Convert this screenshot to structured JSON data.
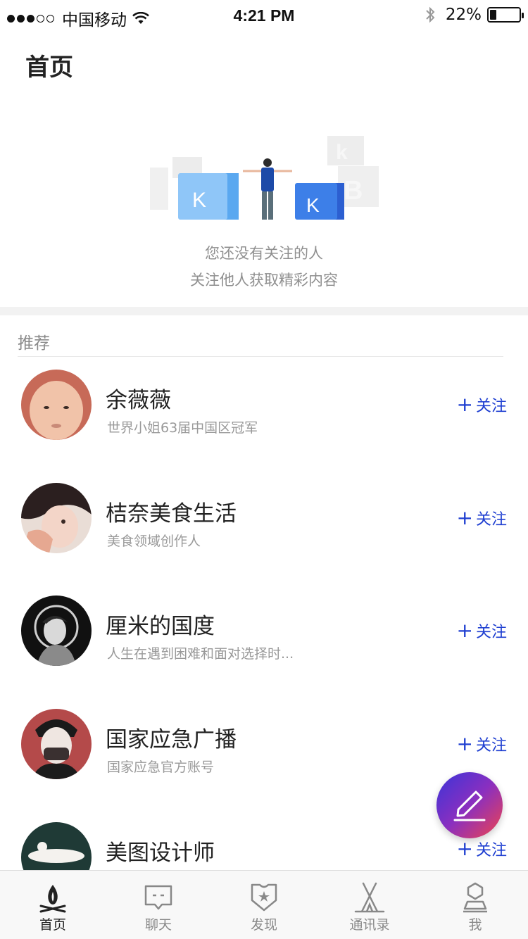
{
  "status_bar": {
    "carrier": "中国移动",
    "time": "4:21 PM",
    "battery_text": "22%",
    "battery_level": 0.22,
    "signal_bars": 3
  },
  "header": {
    "title": "首页"
  },
  "empty_state": {
    "line1": "您还没有关注的人",
    "line2": "关注他人获取精彩内容"
  },
  "recommend": {
    "section_title": "推荐",
    "follow_label": "关注",
    "items": [
      {
        "name": "余薇薇",
        "desc": "世界小姐63届中国区冠军"
      },
      {
        "name": "桔奈美食生活",
        "desc": "美食领域创作人"
      },
      {
        "name": "厘米的国度",
        "desc": "人生在遇到困难和面对选择时..."
      },
      {
        "name": "国家应急广播",
        "desc": "国家应急官方账号"
      },
      {
        "name": "美图设计师",
        "desc": ""
      }
    ]
  },
  "tabs": [
    {
      "label": "首页",
      "icon": "campfire-icon",
      "active": true
    },
    {
      "label": "聊天",
      "icon": "chat-icon",
      "active": false
    },
    {
      "label": "发现",
      "icon": "badge-star-icon",
      "active": false
    },
    {
      "label": "通讯录",
      "icon": "tent-icon",
      "active": false
    },
    {
      "label": "我",
      "icon": "user-icon",
      "active": false
    }
  ],
  "colors": {
    "accent_blue": "#1f3fd1",
    "fab_gradient_start": "#3a34d8",
    "fab_gradient_end": "#f0444c"
  }
}
